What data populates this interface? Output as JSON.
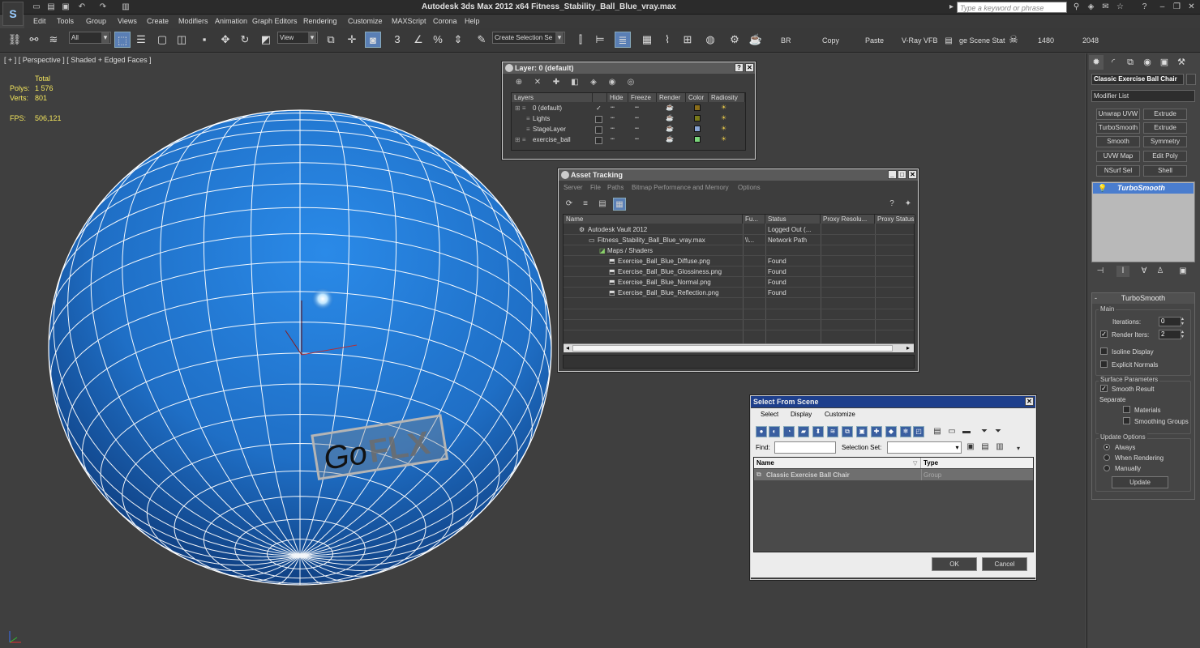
{
  "window": {
    "title": "Autodesk 3ds Max  2012 x64     Fitness_Stability_Ball_Blue_vray.max",
    "search_placeholder": "Type a keyword or phrase"
  },
  "menu": [
    "Edit",
    "Tools",
    "Group",
    "Views",
    "Create",
    "Modifiers",
    "Animation",
    "Graph Editors",
    "Rendering",
    "Customize",
    "MAXScript",
    "Corona",
    "Help"
  ],
  "toolbar": {
    "filter_value": "All",
    "view_value": "View",
    "selection_set_value": "Create Selection Se",
    "labels": [
      "BR",
      "Copy",
      "Paste",
      "V-Ray VFB",
      "ge Scene Stat",
      "1480",
      "2048"
    ]
  },
  "viewport": {
    "label": "[ + ] [ Perspective ] [ Shaded + Edged Faces ]",
    "stats": {
      "header": "Total",
      "polys_label": "Polys:",
      "polys": "1 576",
      "verts_label": "Verts:",
      "verts": "801",
      "fps_label": "FPS:",
      "fps": "506,121"
    },
    "watermark": {
      "a": "Go",
      "b": "FLX"
    },
    "colors": {
      "ball": "#1f6fc6",
      "wire": "#ffffff",
      "background": "#3f3f3f"
    }
  },
  "layer_dialog": {
    "title": "Layer: 0 (default)",
    "columns": [
      "Layers",
      "Hide",
      "Freeze",
      "Render",
      "Color",
      "Radiosity"
    ],
    "rows": [
      {
        "name": "0 (default)",
        "current": "✓",
        "color": "#8a6d1a"
      },
      {
        "name": "Lights",
        "current": "",
        "color": "#7a7a1a"
      },
      {
        "name": "StageLayer",
        "current": "",
        "color": "#8aa6d6"
      },
      {
        "name": "exercise_ball",
        "current": "",
        "color": "#7ad67a"
      }
    ]
  },
  "asset_tracking": {
    "title": "Asset Tracking",
    "menu": [
      "Server",
      "File",
      "Paths",
      "Bitmap Performance and Memory",
      "Options"
    ],
    "columns": [
      "Name",
      "Fu...",
      "Status",
      "Proxy Resolu...",
      "Proxy Status"
    ],
    "rows": [
      {
        "name": "Autodesk Vault 2012",
        "full": "",
        "status": "Logged Out (..."
      },
      {
        "name": "Fitness_Stability_Ball_Blue_vray.max",
        "full": "\\\\...",
        "status": "Network Path"
      },
      {
        "name": "Maps / Shaders",
        "full": "",
        "status": ""
      },
      {
        "name": "Exercise_Ball_Blue_Diffuse.png",
        "full": "",
        "status": "Found"
      },
      {
        "name": "Exercise_Ball_Blue_Glossiness.png",
        "full": "",
        "status": "Found"
      },
      {
        "name": "Exercise_Ball_Blue_Normal.png",
        "full": "",
        "status": "Found"
      },
      {
        "name": "Exercise_Ball_Blue_Reflection.png",
        "full": "",
        "status": "Found"
      }
    ]
  },
  "select_from_scene": {
    "title": "Select From Scene",
    "menu": [
      "Select",
      "Display",
      "Customize"
    ],
    "find_label": "Find:",
    "selection_set_label": "Selection Set:",
    "columns": [
      "Name",
      "Type"
    ],
    "rows": [
      {
        "name": "Classic Exercise Ball Chair",
        "type": "Group"
      }
    ],
    "ok": "OK",
    "cancel": "Cancel"
  },
  "command_panel": {
    "object_name": "Classic Exercise Ball Chair",
    "modifier_list": "Modifier List",
    "buttons": [
      "Unwrap UVW",
      "Extrude",
      "TurboSmooth",
      "Extrude",
      "Smooth",
      "Symmetry",
      "UVW Map",
      "Edit Poly",
      "NSurf Sel",
      "Shell"
    ],
    "stack_item": "TurboSmooth",
    "rollout": {
      "title": "TurboSmooth",
      "main_label": "Main",
      "iterations_label": "Iterations:",
      "iterations": "0",
      "render_iters_label": "Render Iters:",
      "render_iters": "2",
      "isoline": "Isoline Display",
      "explicit": "Explicit Normals",
      "surface_label": "Surface Parameters",
      "smooth_result": "Smooth Result",
      "separate": "Separate",
      "materials": "Materials",
      "smoothing_groups": "Smoothing Groups",
      "update_label": "Update Options",
      "always": "Always",
      "when_rendering": "When Rendering",
      "manually": "Manually",
      "update_btn": "Update"
    }
  }
}
